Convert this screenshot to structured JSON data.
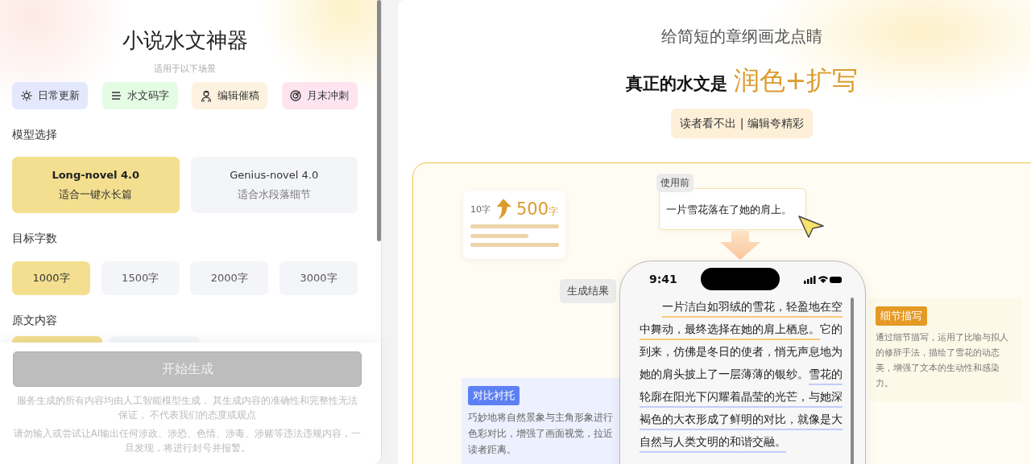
{
  "app": {
    "title": "小说水文神器",
    "subtitle": "适用于以下场景"
  },
  "scenes": [
    {
      "label": "日常更新",
      "kind": "sun",
      "color": "#e3e8fd"
    },
    {
      "label": "水文码字",
      "kind": "lines",
      "color": "#e4fbe4"
    },
    {
      "label": "编辑催稿",
      "kind": "person",
      "color": "#fdf2e0"
    },
    {
      "label": "月末冲刺",
      "kind": "target",
      "color": "#fde4ef"
    }
  ],
  "model_section": {
    "label": "模型选择",
    "options": [
      {
        "name": "Long-novel 4.0",
        "description": "适合一键水长篇",
        "selected": true
      },
      {
        "name": "Genius-novel 4.0",
        "description": "适合水段落细节",
        "selected": false
      }
    ]
  },
  "length_section": {
    "label": "目标字数",
    "options": [
      {
        "label": "1000字",
        "selected": true
      },
      {
        "label": "1500字",
        "selected": false
      },
      {
        "label": "2000字",
        "selected": false
      },
      {
        "label": "3000字",
        "selected": false
      }
    ]
  },
  "source_section": {
    "label": "原文内容",
    "options": [
      {
        "selected": true
      },
      {
        "selected": false
      }
    ]
  },
  "generate_button": {
    "label": "开始生成",
    "disabled": true
  },
  "disclaimers": [
    "服务生成的所有内容均由人工智能模型生成， 其生成内容的准确性和完整性无法保证， 不代表我们的态度或观点",
    "请勿输入或尝试让AI输出任何涉政、涉恐、色情、涉毒、涉赌等违法违规内容，一旦发现，将进行封号并报警。"
  ],
  "hero": {
    "tagline": "给简短的章纲画龙点睛",
    "headline_prefix": "真正的水文是",
    "headline_highlight": "润色+扩写",
    "badge": "读者看不出 | 编辑夸精彩"
  },
  "demo": {
    "stats": {
      "from": "10字",
      "to_number": "500",
      "to_unit": "字"
    },
    "before_tag": "使用前",
    "before_text": "一片雪花落在了她的肩上。",
    "after_tag": "生成结果",
    "phone": {
      "time": "9:41",
      "segments": [
        {
          "text": "一片洁白如羽绒的雪花，轻盈地在空中舞动，最终选择在她的肩上栖息。",
          "kind": "detail"
        },
        {
          "text": "它的到来，仿佛是冬日的使者，悄无声息地为她的肩头披上了一层薄薄的银纱。",
          "kind": "plain"
        },
        {
          "text": "雪花的轮廓在阳光下闪耀着晶莹的光芒，与她深褐色的大衣形成了鲜明的对比，就像是大自然与人类文明的和谐交融。",
          "kind": "contrast"
        }
      ]
    },
    "notes": [
      {
        "kind": "detail",
        "tag": "细节描写",
        "text": "通过细节描写，运用了比喻与拟人的修辞手法，描绘了雪花的动态美，增强了文本的生动性和感染力。"
      },
      {
        "kind": "contrast",
        "tag": "对比衬托",
        "text": "巧妙地将自然景象与主角形象进行色彩对比，增强了画面视觉，拉近读者距离。"
      }
    ]
  }
}
